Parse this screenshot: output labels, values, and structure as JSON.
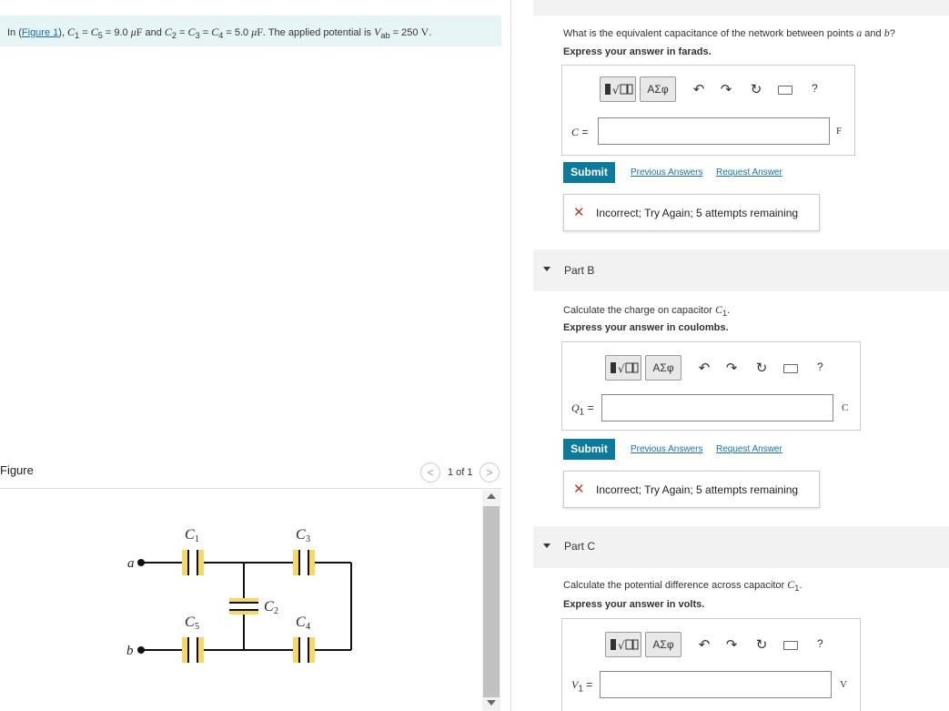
{
  "intro": {
    "prefix": "In (",
    "figure_link": "Figure 1",
    "mid1": "), ",
    "c1": "C",
    "sub1": "1",
    "eq1": " = ",
    "c5": "C",
    "sub5": "5",
    "val1": " = 9.0 ",
    "unit_mu": "μ",
    "unit_F1": "F",
    "and": " and ",
    "c2": "C",
    "sub2": "2",
    "c3": "C",
    "sub3": "3",
    "c4": "C",
    "sub4": "4",
    "val2": " = 5.0 ",
    "unit_F2": "F",
    "tail": ". The applied potential is ",
    "v": "V",
    "vsub": "ab",
    "vval": " = 250 ",
    "vunit": "V",
    "end": "."
  },
  "figure": {
    "title": "Figure",
    "pager": "1 of 1",
    "prev_icon": "<",
    "next_icon": ">",
    "labels": {
      "a": "a",
      "b": "b",
      "C1": "C",
      "C1s": "1",
      "C2": "C",
      "C2s": "2",
      "C3": "C",
      "C3s": "3",
      "C4": "C",
      "C4s": "4",
      "C5": "C",
      "C5s": "5"
    }
  },
  "toolbar": {
    "greek": "ΑΣφ",
    "undo": "↶",
    "redo": "↷",
    "reset": "↻",
    "help": "?"
  },
  "partA": {
    "question": "What is the equivalent capacitance of the network between points ",
    "q_a": "a",
    "q_and": " and ",
    "q_b": "b",
    "q_end": "?",
    "instruction": "Express your answer in farads.",
    "var": "C",
    "var_eq": " =",
    "unit": "F",
    "submit": "Submit",
    "previous": "Previous Answers",
    "request": "Request Answer",
    "feedback": "Incorrect; Try Again; 5 attempts remaining"
  },
  "partB": {
    "label": "Part B",
    "question": "Calculate the charge on capacitor ",
    "q_c": "C",
    "q_sub": "1",
    "q_end": ".",
    "instruction": "Express your answer in coulombs.",
    "var": "Q",
    "var_sub": "1",
    "var_eq": " =",
    "unit": "C",
    "submit": "Submit",
    "previous": "Previous Answers",
    "request": "Request Answer",
    "feedback": "Incorrect; Try Again; 5 attempts remaining"
  },
  "partC": {
    "label": "Part C",
    "question": "Calculate the potential difference across capacitor ",
    "q_c": "C",
    "q_sub": "1",
    "q_end": ".",
    "instruction": "Express your answer in volts.",
    "var": "V",
    "var_sub": "1",
    "var_eq": " =",
    "unit": "V"
  },
  "colors": {
    "submit": "#0d7a9c",
    "intro_bg": "#e6f4f6",
    "capacitor_fill": "#f5d76e",
    "error": "#c0392b"
  }
}
